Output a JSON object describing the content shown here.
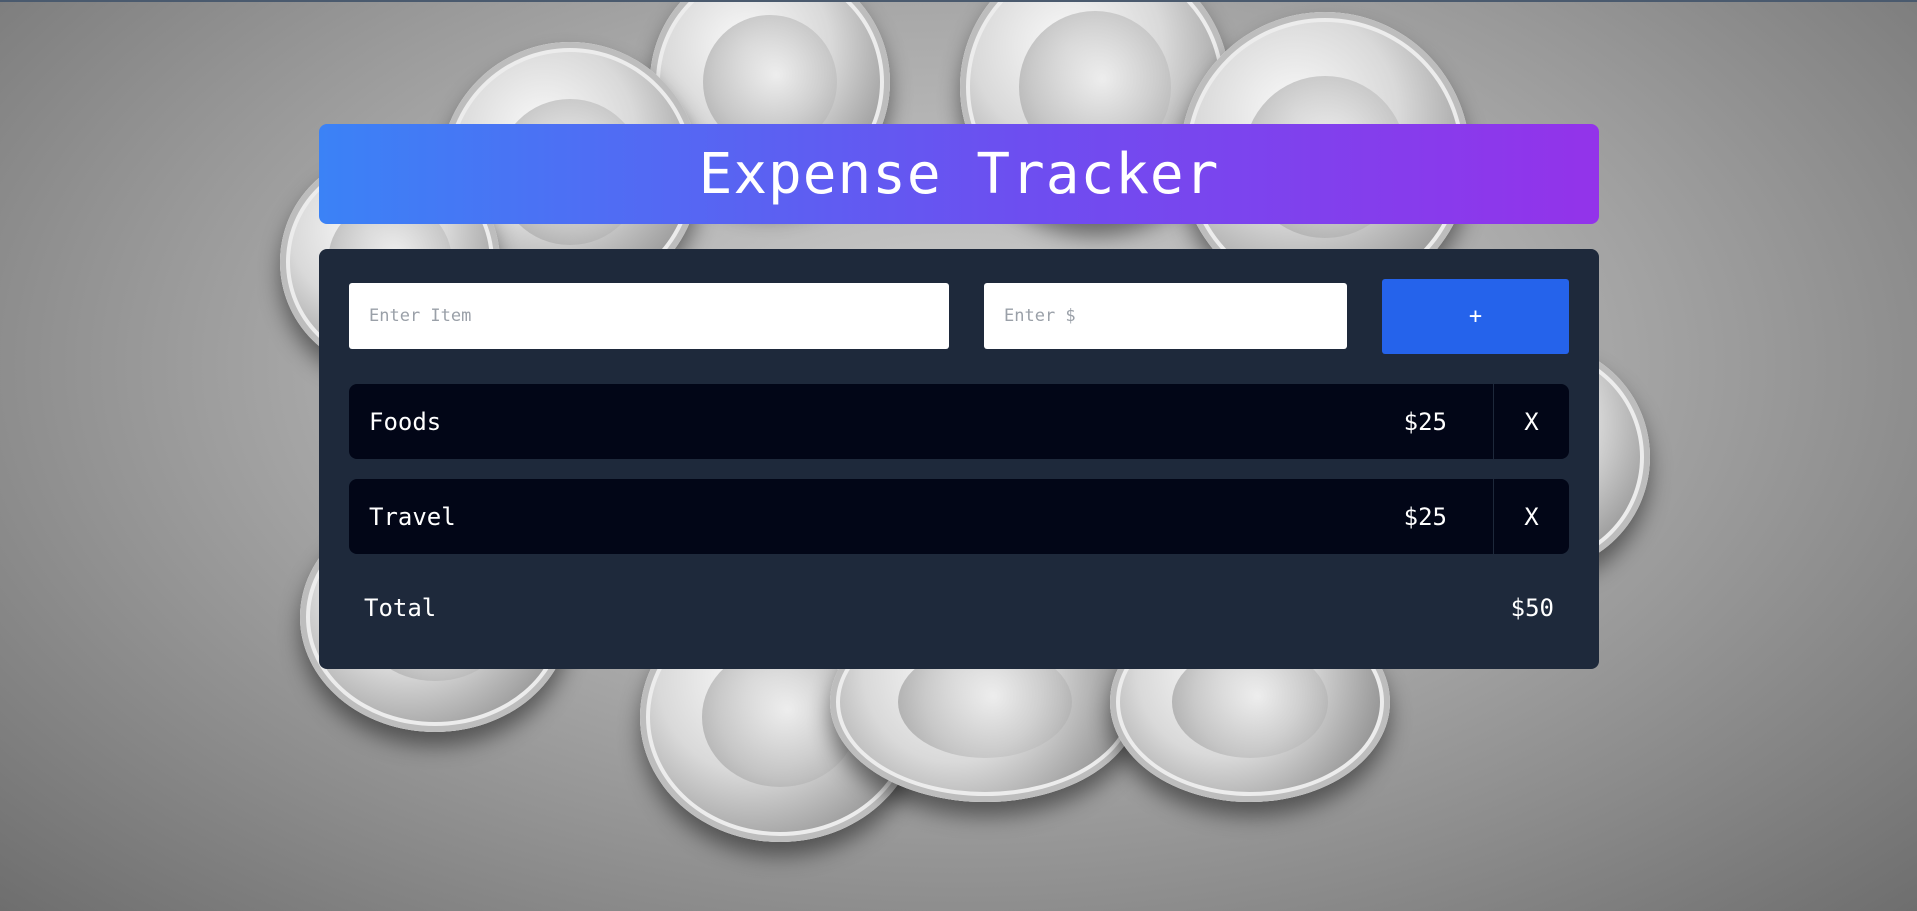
{
  "header": {
    "title": "Expense Tracker"
  },
  "form": {
    "item_placeholder": "Enter Item",
    "amount_placeholder": "Enter $",
    "add_label": "+"
  },
  "expenses": [
    {
      "name": "Foods",
      "amount": "$25",
      "delete_label": "X"
    },
    {
      "name": "Travel",
      "amount": "$25",
      "delete_label": "X"
    }
  ],
  "total": {
    "label": "Total",
    "value": "$50"
  },
  "colors": {
    "header_gradient_start": "#3b82f6",
    "header_gradient_end": "#9333ea",
    "panel_bg": "#1e293b",
    "row_bg": "#020617",
    "add_button": "#2563eb"
  }
}
